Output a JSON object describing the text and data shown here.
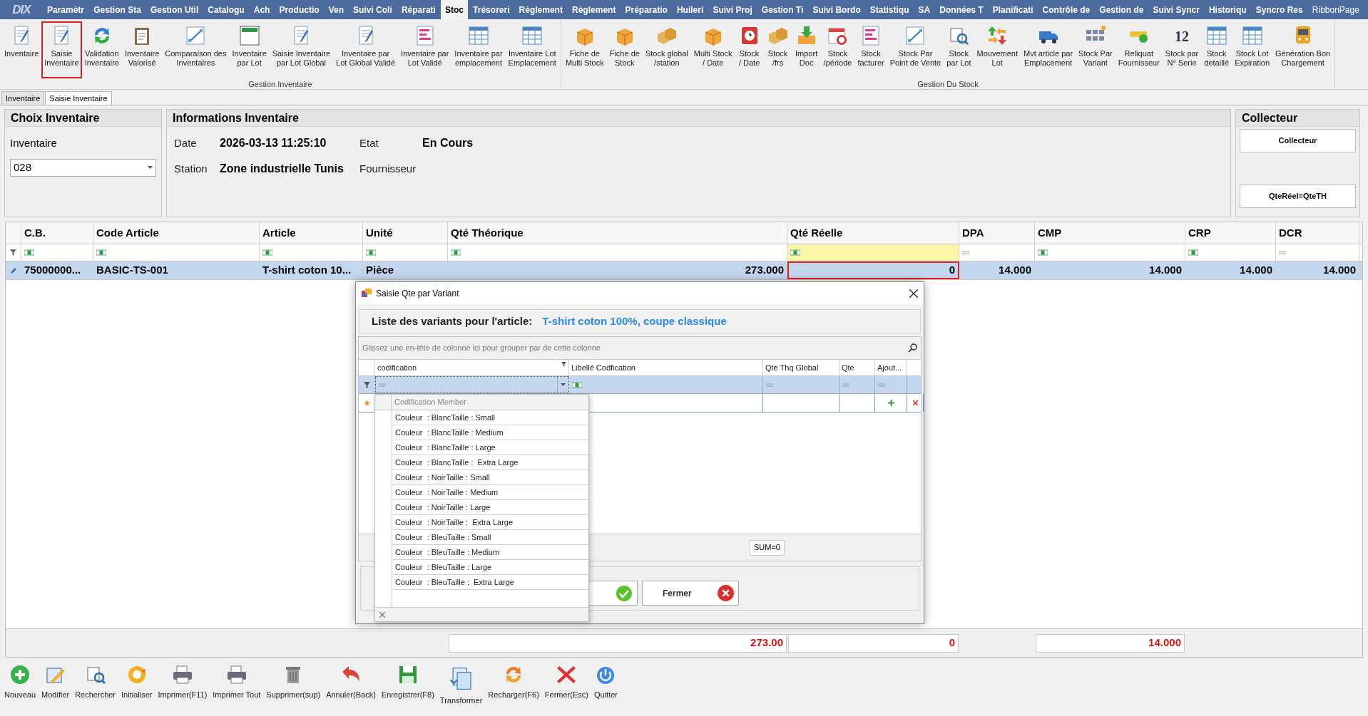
{
  "logo": "DIX",
  "menu": [
    {
      "label": "Paramètr",
      "selected": false
    },
    {
      "label": "Gestion Sta",
      "selected": false
    },
    {
      "label": "Gestion Util",
      "selected": false
    },
    {
      "label": "Catalogu",
      "selected": false
    },
    {
      "label": "Ach",
      "selected": false
    },
    {
      "label": "Productio",
      "selected": false
    },
    {
      "label": "Ven",
      "selected": false
    },
    {
      "label": "Suivi Coli",
      "selected": false
    },
    {
      "label": "Réparati",
      "selected": false
    },
    {
      "label": "Stoc",
      "selected": true
    },
    {
      "label": "Trésoreri",
      "selected": false
    },
    {
      "label": "Règlement",
      "selected": false
    },
    {
      "label": "Règlement",
      "selected": false
    },
    {
      "label": "Préparatio",
      "selected": false
    },
    {
      "label": "Huileri",
      "selected": false
    },
    {
      "label": "Suivi Proj",
      "selected": false
    },
    {
      "label": "Gestion Ti",
      "selected": false
    },
    {
      "label": "Suivi Bordo",
      "selected": false
    },
    {
      "label": "Statistiqu",
      "selected": false
    },
    {
      "label": "SA",
      "selected": false
    },
    {
      "label": "Données T",
      "selected": false
    },
    {
      "label": "Planificati",
      "selected": false
    },
    {
      "label": "Contrôle de",
      "selected": false
    },
    {
      "label": "Gestion de",
      "selected": false
    },
    {
      "label": "Suivi Syncr",
      "selected": false
    },
    {
      "label": "Historiqu",
      "selected": false
    },
    {
      "label": "Syncro Res",
      "selected": false
    },
    {
      "label": "RibbonPage",
      "selected": false
    }
  ],
  "ribbon": [
    {
      "label": "Gestion Inventaire",
      "buttons": [
        {
          "lines": [
            "Inventaire"
          ],
          "selected": false
        },
        {
          "lines": [
            "Saisie",
            "Inventaire"
          ],
          "selected": true
        },
        {
          "lines": [
            "Validation",
            "Inventaire"
          ],
          "selected": false
        },
        {
          "lines": [
            "Inventaire",
            "Valorisé"
          ],
          "selected": false
        },
        {
          "lines": [
            "Comparaison des",
            "Inventaires"
          ],
          "selected": false
        },
        {
          "lines": [
            "Inventaire",
            "par Lot"
          ],
          "selected": false
        },
        {
          "lines": [
            "Saisie Inventaire",
            "par Lot Global"
          ],
          "selected": false
        },
        {
          "lines": [
            "Inventaire par",
            "Lot Global Validé"
          ],
          "selected": false
        },
        {
          "lines": [
            "Inventaire par",
            "Lot Validé"
          ],
          "selected": false
        },
        {
          "lines": [
            "Inventaire par",
            "emplacement"
          ],
          "selected": false
        },
        {
          "lines": [
            "Inventaire Lot",
            "Emplacement"
          ],
          "selected": false
        }
      ]
    },
    {
      "label": "Gestion Du Stock",
      "buttons": [
        {
          "lines": [
            "Fiche de",
            "Multi Stock"
          ],
          "selected": false
        },
        {
          "lines": [
            "Fiche de",
            "Stock"
          ],
          "selected": false
        },
        {
          "lines": [
            "Stock global",
            "/station"
          ],
          "selected": false
        },
        {
          "lines": [
            "Multi Stock",
            "/ Date"
          ],
          "selected": false
        },
        {
          "lines": [
            "Stock",
            "/ Date"
          ],
          "selected": false
        },
        {
          "lines": [
            "Stock",
            "/frs"
          ],
          "selected": false
        },
        {
          "lines": [
            "Import",
            "Doc"
          ],
          "selected": false
        },
        {
          "lines": [
            "Stock",
            "/période"
          ],
          "selected": false
        },
        {
          "lines": [
            "Stock",
            "facturer"
          ],
          "selected": false
        },
        {
          "lines": [
            "Stock Par",
            "Point de Vente"
          ],
          "selected": false
        },
        {
          "lines": [
            "Stock",
            "par Lot"
          ],
          "selected": false
        },
        {
          "lines": [
            "Mouvement",
            "Lot"
          ],
          "selected": false
        },
        {
          "lines": [
            "Mvt article par",
            "Emplacement"
          ],
          "selected": false
        },
        {
          "lines": [
            "Stock Par",
            "Variant"
          ],
          "selected": false
        },
        {
          "lines": [
            "Reliquat",
            "Fournisseur"
          ],
          "selected": false
        },
        {
          "lines": [
            "Stock par",
            "N° Serie"
          ],
          "icon_text": "12",
          "selected": false
        },
        {
          "lines": [
            "Stock",
            "detaillé"
          ],
          "selected": false
        },
        {
          "lines": [
            "Stock Lot",
            "Expiration"
          ],
          "selected": false
        },
        {
          "lines": [
            "Génération Bon",
            "Chargement"
          ],
          "selected": false
        }
      ]
    }
  ],
  "tabs": [
    {
      "label": "Inventaire",
      "selected": false
    },
    {
      "label": "Saisie Inventaire",
      "selected": true
    }
  ],
  "choix": {
    "title": "Choix Inventaire",
    "label": "Inventaire",
    "value": "028"
  },
  "info": {
    "title": "Informations Inventaire",
    "fields": [
      {
        "label": "Date",
        "value": "2026-03-13 11:25:10"
      },
      {
        "label": "Etat",
        "value": "En Cours"
      },
      {
        "label": "Station",
        "value": "Zone industrielle Tunis"
      },
      {
        "label": "Fournisseur"
      }
    ]
  },
  "collecteur": {
    "title": "Collecteur",
    "buttons": [
      "Collecteur",
      "QteRéel=QteTH"
    ]
  },
  "grid": {
    "columns": [
      {
        "label": "C.B.",
        "kind": "text",
        "numeric": false,
        "filter_focused": false
      },
      {
        "label": "Code Article",
        "kind": "text",
        "numeric": false,
        "filter_focused": false
      },
      {
        "label": "Article",
        "kind": "text",
        "numeric": false,
        "filter_focused": false
      },
      {
        "label": "Unité",
        "kind": "text",
        "numeric": false,
        "filter_focused": false
      },
      {
        "label": "Qté Théorique",
        "kind": "text",
        "numeric": true,
        "filter_focused": false,
        "total": "273.00"
      },
      {
        "label": "Qté Réelle",
        "kind": "text",
        "numeric": true,
        "filter_focused": true,
        "total": "0"
      },
      {
        "label": "DPA",
        "kind": "number",
        "numeric": true,
        "filter_focused": false
      },
      {
        "label": "CMP",
        "kind": "text",
        "numeric": true,
        "filter_focused": false,
        "total": "14.000"
      },
      {
        "label": "CRP",
        "kind": "text",
        "numeric": true,
        "filter_focused": false
      },
      {
        "label": "DCR",
        "kind": "number",
        "numeric": true,
        "filter_focused": false
      }
    ],
    "rows": [
      {
        "selected": true,
        "cells": [
          {
            "text": "75000000...",
            "focused": false
          },
          {
            "text": "BASIC-TS-001",
            "focused": false
          },
          {
            "text": "T-shirt coton 10...",
            "focused": false
          },
          {
            "text": "Pièce",
            "focused": false
          },
          {
            "text": "273.000",
            "focused": false
          },
          {
            "text": "0",
            "focused": true
          },
          {
            "text": "14.000",
            "focused": false
          },
          {
            "text": "14.000",
            "focused": false
          },
          {
            "text": "14.000",
            "focused": false
          },
          {
            "text": "14.000",
            "focused": false
          }
        ]
      }
    ]
  },
  "dialog": {
    "title": "Saisie Qte par Variant",
    "heading": "Liste des variants pour l'article:",
    "article": "T-shirt coton 100%, coupe classique",
    "group_hint": "Glissez une en-tête de colonne ici pour grouper par de cette colonne",
    "columns": [
      {
        "label": "codification",
        "kind": "combo"
      },
      {
        "label": "Libellé Codfication",
        "kind": "text"
      },
      {
        "label": "Qte Thq Global",
        "kind": "number"
      },
      {
        "label": "Qte",
        "kind": "number"
      },
      {
        "label": "Ajout...",
        "kind": "number"
      }
    ],
    "footer": "SUM=0",
    "close_button": "Fermer",
    "dropdown": {
      "header": "Codification Member",
      "items": [
        "Couleur  : BlancTaille : Small",
        "Couleur  : BlancTaille : Medium",
        "Couleur  : BlancTaille : Large",
        "Couleur  : BlancTaille :  Extra Large",
        "Couleur  : NoirTaille : Small",
        "Couleur  : NoirTaille : Medium",
        "Couleur  : NoirTaille : Large",
        "Couleur  : NoirTaille :  Extra Large",
        "Couleur  : BleuTaille : Small",
        "Couleur  : BleuTaille : Medium",
        "Couleur  : BleuTaille : Large",
        "Couleur  : BleuTaille :  Extra Large"
      ]
    }
  },
  "toolbar": [
    {
      "label": "Nouveau",
      "kind": "plus"
    },
    {
      "label": "Modifier",
      "kind": "edit"
    },
    {
      "label": "Rechercher",
      "kind": "search"
    },
    {
      "label": "Initialiser",
      "kind": "reset"
    },
    {
      "label": "Imprimer(F11)",
      "kind": "print"
    },
    {
      "label": "Imprimer Tout",
      "kind": "print"
    },
    {
      "label": "Supprimer(sup)",
      "kind": "trash"
    },
    {
      "label": "Annuler(Back)",
      "kind": "undo"
    },
    {
      "label": "Enregistrer(F8)",
      "kind": "save"
    },
    {
      "label": "Transformer",
      "kind": "transform"
    },
    {
      "label": "Recharger(F6)",
      "kind": "reload"
    },
    {
      "label": "Fermer(Esc)",
      "kind": "close"
    },
    {
      "label": "Quitter",
      "kind": "power"
    }
  ]
}
